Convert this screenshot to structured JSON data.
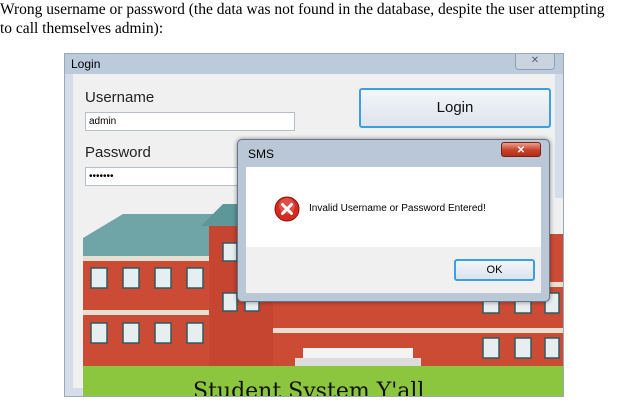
{
  "caption": {
    "line1": "Wrong username or password (the data was not found in the database, despite the user attempting",
    "line2": "to call themselves admin):"
  },
  "login_window": {
    "title": "Login",
    "close_glyph": "✕",
    "username_label": "Username",
    "username_value": "admin",
    "password_label": "Password",
    "password_value": "•••••••",
    "login_button": "Login",
    "banner_text": "Student System Y'all"
  },
  "dialog": {
    "title": "SMS",
    "close_glyph": "✕",
    "message": "Invalid Username or Password Entered!",
    "ok_button": "OK",
    "icon": "error-icon"
  },
  "colors": {
    "sky": "#c8d4e2",
    "brick": "#cc4b34",
    "roof": "#6fa5a6",
    "window": "#e7eef0",
    "grass": "#8cc63f",
    "error_red": "#d42a1f",
    "focus_blue": "#3c9fe0"
  }
}
